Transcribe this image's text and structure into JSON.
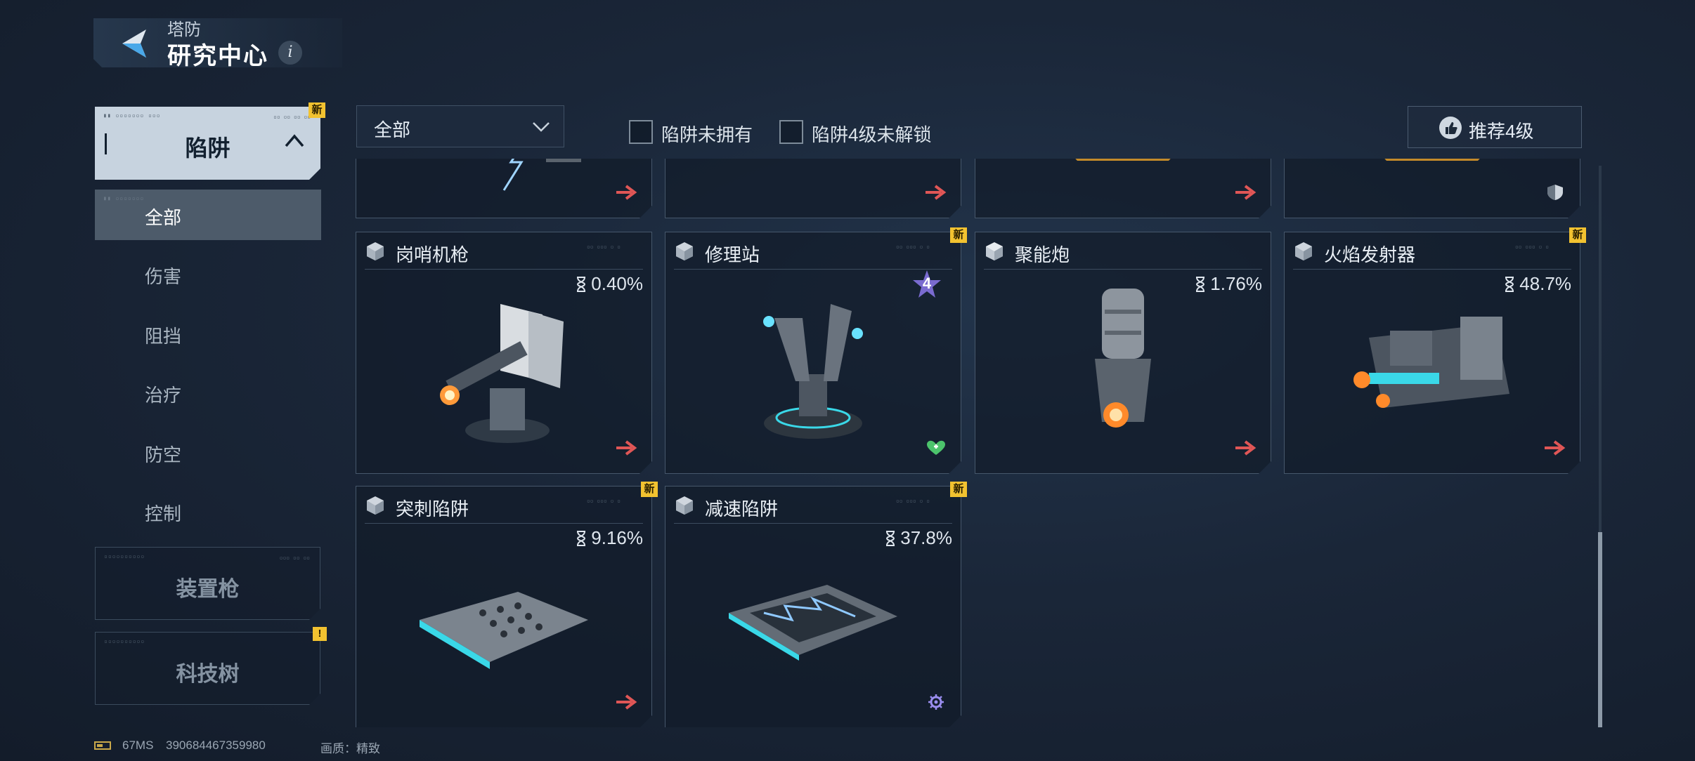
{
  "header": {
    "subtitle": "塔防",
    "title": "研究中心",
    "info_icon": "i"
  },
  "sidebar": {
    "main_category": {
      "label": "陷阱",
      "badge": "新"
    },
    "sub_items": [
      {
        "label": "全部",
        "active": true
      },
      {
        "label": "伤害"
      },
      {
        "label": "阻挡"
      },
      {
        "label": "治疗"
      },
      {
        "label": "防空"
      },
      {
        "label": "控制"
      }
    ],
    "other_categories": [
      {
        "label": "装置枪"
      },
      {
        "label": "科技树",
        "badge": "!"
      }
    ]
  },
  "filters": {
    "dropdown_value": "全部",
    "checkbox_1": "陷阱未拥有",
    "checkbox_2": "陷阱4级未解锁",
    "recommend_button": "推荐4级"
  },
  "cards": [
    {
      "name": "岗哨机枪",
      "percent": "0.40%",
      "new": false,
      "corner_icon": "arrow-icon"
    },
    {
      "name": "修理站",
      "percent": "",
      "level": "4",
      "new": true,
      "corner_icon": "heal-icon"
    },
    {
      "name": "聚能炮",
      "percent": "1.76%",
      "new": false,
      "corner_icon": "arrow-icon"
    },
    {
      "name": "火焰发射器",
      "percent": "48.7%",
      "new": true,
      "corner_icon": "arrow-icon"
    },
    {
      "name": "突刺陷阱",
      "percent": "9.16%",
      "new": true,
      "corner_icon": "arrow-icon"
    },
    {
      "name": "减速陷阱",
      "percent": "37.8%",
      "new": true,
      "corner_icon": "gear-icon"
    }
  ],
  "new_badge": "新",
  "status_bar": {
    "ping": "67MS",
    "uid": "390684467359980",
    "quality_label": "画质：",
    "quality_value": "精致"
  },
  "colors": {
    "accent_arrow": "#e05656",
    "badge_yellow": "#f2c230",
    "active_tab": "#c7d3df"
  }
}
